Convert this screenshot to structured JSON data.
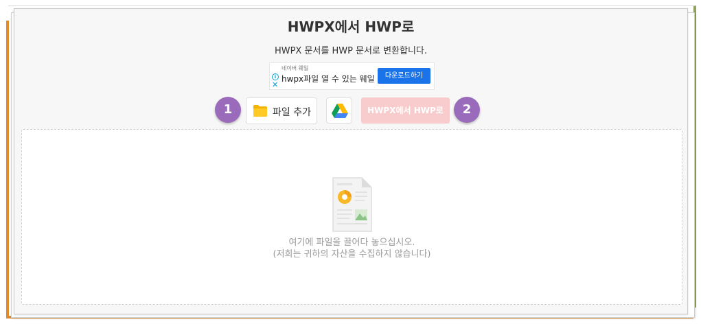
{
  "page": {
    "title": "HWPX에서 HWP로",
    "subtitle": "HWPX 문서를 HWP 문서로 변환합니다."
  },
  "ad": {
    "small_label": "네이버 웨일",
    "main_text": "hwpx파일 열 수 있는 웨일",
    "button_label": "다운로드하기",
    "info_glyph": "i",
    "close_glyph": "✕"
  },
  "steps": {
    "step1": "1",
    "step2": "2"
  },
  "toolbar": {
    "add_file_label": "파일 추가",
    "add_file_icon": "folder-icon",
    "drive_icon": "google-drive-icon",
    "convert_label": "HWPX에서 HWP로"
  },
  "dropzone": {
    "icon": "document-icon",
    "line1": "여기에 파일을 끌어다 놓으십시오.",
    "line2": "(저희는 귀하의 자산을 수집하지 않습니다)"
  },
  "colors": {
    "step_badge": "#9b6bbb",
    "convert_disabled": "#f8cccc",
    "ad_button": "#1a73e8",
    "accent_orange": "#e08a2c",
    "accent_green": "#8ea35c"
  }
}
